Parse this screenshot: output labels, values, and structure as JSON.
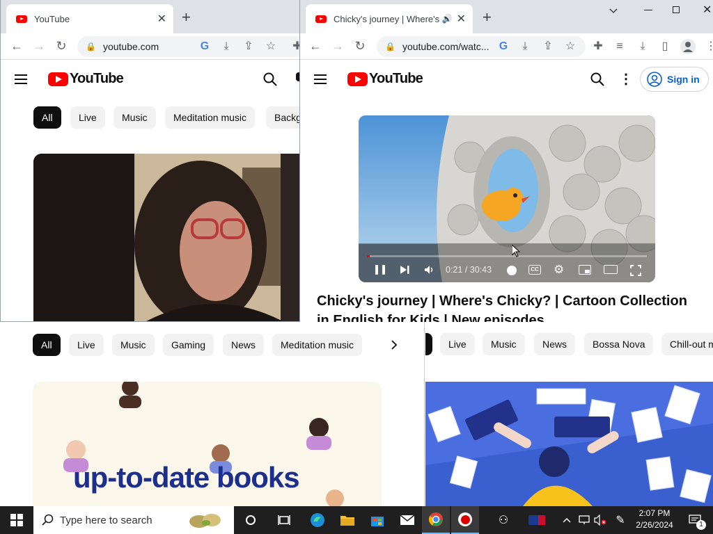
{
  "left_window": {
    "tab_title": "YouTube",
    "url": "youtube.com",
    "logo_text": "YouTube",
    "chips": [
      "All",
      "Live",
      "Music",
      "Meditation music",
      "Backg"
    ]
  },
  "right_window": {
    "tab_title": "Chicky's journey | Where's Ch",
    "url": "youtube.com/watc...",
    "logo_text": "YouTube",
    "sign_in_label": "Sign in",
    "video": {
      "time_current": "0:21",
      "time_separator": "/",
      "time_total": "30:43",
      "cc_label": "CC",
      "progress_fraction": 0.011
    },
    "video_title": "Chicky's journey | Where's Chicky? | Cartoon Collection in English for Kids | New episodes"
  },
  "bottom_left_window": {
    "chips": [
      "All",
      "Live",
      "Music",
      "Gaming",
      "News",
      "Meditation music"
    ],
    "thumbnail_text": "up-to-date books"
  },
  "bottom_right_window": {
    "chips": [
      "Live",
      "Music",
      "News",
      "Bossa Nova",
      "Chill-out m"
    ]
  },
  "taskbar": {
    "search_placeholder": "Type here to search",
    "time": "2:07 PM",
    "date": "2/26/2024",
    "notification_count": "1"
  },
  "colors": {
    "youtube_red": "#ff0000",
    "sign_in_blue": "#065fd4",
    "chip_selected": "#0f0f0f",
    "taskbar": "#1f1f1f"
  }
}
